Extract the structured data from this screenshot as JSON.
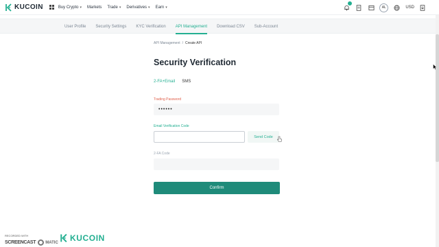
{
  "brand": {
    "name": "KUCOIN",
    "accent_color": "#23af91"
  },
  "topnav": {
    "items": [
      {
        "label": "Buy Crypto",
        "has_dropdown": true
      },
      {
        "label": "Markets",
        "has_dropdown": false
      },
      {
        "label": "Trade",
        "has_dropdown": true
      },
      {
        "label": "Derivatives",
        "has_dropdown": true
      },
      {
        "label": "Earn",
        "has_dropdown": true
      }
    ],
    "icons": [
      "notification-bell-icon",
      "orders-icon",
      "assets-icon",
      "avatar",
      "globe-icon",
      "download-icon"
    ],
    "avatar_initials": "AL",
    "currency": "USD"
  },
  "subnav": {
    "tabs": [
      {
        "label": "User Profile",
        "active": false
      },
      {
        "label": "Security Settings",
        "active": false
      },
      {
        "label": "KYC Verification",
        "active": false
      },
      {
        "label": "API Management",
        "active": true
      },
      {
        "label": "Download CSV",
        "active": false
      },
      {
        "label": "Sub-Account",
        "active": false
      }
    ]
  },
  "breadcrumb": {
    "parent": "API Management",
    "separator": "/",
    "current": "Create API"
  },
  "form": {
    "title": "Security Verification",
    "verify_tabs": [
      {
        "label": "2-FA+Email",
        "active": true
      },
      {
        "label": "SMS",
        "active": false
      }
    ],
    "trading_password": {
      "label": "Trading Password",
      "value": "••••••"
    },
    "email_code": {
      "label": "Email Verification Code",
      "value": "",
      "send_label": "Send Code"
    },
    "twofa_code": {
      "label": "2-FA Code",
      "value": ""
    },
    "confirm_label": "Confirm"
  },
  "watermarks": {
    "recorded_with": "RECORDED WITH",
    "screencast": "SCREENCAST",
    "matic": "MATIC",
    "kucoin": "KUCOIN"
  }
}
